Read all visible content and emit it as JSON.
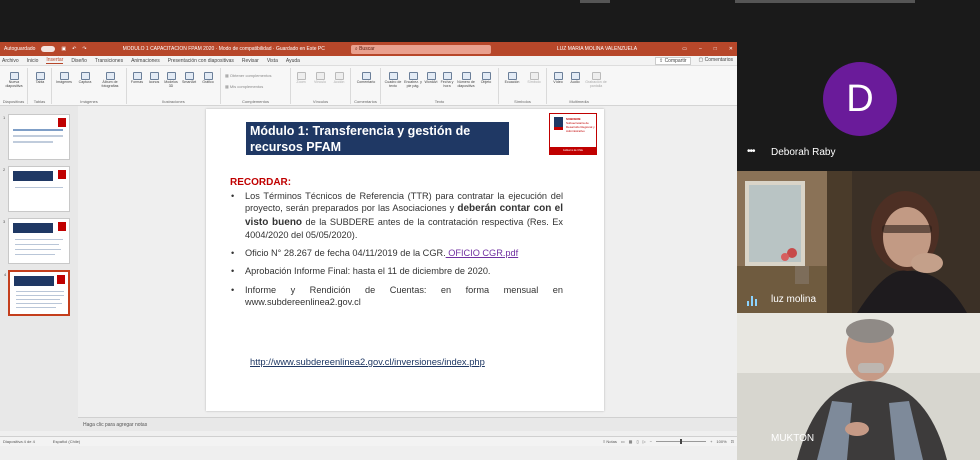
{
  "ppt": {
    "autosave_label": "Autoguardado",
    "title": "MODULO 1 CAPACITACION FPAM 2020 · Modo de compatibilidad · Guardado en Este PC",
    "search_placeholder": "Buscar",
    "user": "LUZ MARIA MOLINA VALENZUELA",
    "menu": [
      "Archivo",
      "Inicio",
      "Insertar",
      "Diseño",
      "Transiciones",
      "Animaciones",
      "Presentación con diapositivas",
      "Revisar",
      "Vista",
      "Ayuda"
    ],
    "active_menu": "Insertar",
    "share_label": "Compartir",
    "comments_label": "Comentarios",
    "ribbon_groups": [
      {
        "label": "Diapositivas",
        "buttons": [
          "Nueva diapositiva"
        ]
      },
      {
        "label": "Tablas",
        "buttons": [
          "Tabla"
        ]
      },
      {
        "label": "Imágenes",
        "buttons": [
          "Imágenes",
          "Captura",
          "Álbum de fotografías"
        ]
      },
      {
        "label": "Ilustraciones",
        "buttons": [
          "Formas",
          "Iconos",
          "Modelos 3D",
          "SmartArt",
          "Gráfico"
        ]
      },
      {
        "label": "Complementos",
        "buttons": [
          "Obtener complementos",
          "Mis complementos"
        ]
      },
      {
        "label": "Vínculos",
        "buttons": [
          "Zoom",
          "Vínculo",
          "Acción"
        ]
      },
      {
        "label": "Comentarios",
        "buttons": [
          "Comentario"
        ]
      },
      {
        "label": "Texto",
        "buttons": [
          "Cuadro de texto",
          "Encabez. y pie pág.",
          "WordArt",
          "Fecha y hora",
          "Número de diapositiva",
          "Objeto"
        ]
      },
      {
        "label": "Símbolos",
        "buttons": [
          "Ecuación",
          "Símbolo"
        ]
      },
      {
        "label": "Multimedia",
        "buttons": [
          "Vídeo",
          "Audio",
          "Grabación de pantalla"
        ]
      }
    ],
    "thumb_numbers": [
      "1",
      "2",
      "3",
      "4"
    ],
    "notes_placeholder": "Haga clic para agregar notas",
    "status_slide": "Diapositiva 4 de 4",
    "status_lang": "Español (Chile)",
    "status_notes": "Notas",
    "zoom": "100%"
  },
  "slide": {
    "title": "Módulo 1: Transferencia y gestión de recursos PFAM",
    "logo_text": "SUBDERE",
    "logo_subtext": "Subsecretaría de Desarrollo Regional y Administrativo",
    "logo_footer": "Gobierno de Chile",
    "recordar": "RECORDAR:",
    "b1_pre": "Los Términos Técnicos de Referencia (TTR) para contratar la ejecución del proyecto, serán preparados por las Asociaciones y ",
    "b1_bold": "deberán contar con el visto bueno",
    "b1_post": " de la SUBDERE antes de la contratación respectiva (Res. Ex 4004/2020 del 05/05/2020).",
    "b2_text": "Oficio N° 28.267 de fecha 04/11/2019 de la CGR.",
    "b2_link": " OFICIO CGR.pdf",
    "b3_text": "Aprobación Informe Final: hasta el 11 de diciembre de 2020.",
    "b4_text": "Informe y Rendición de Cuentas: en forma mensual en www.subdereenlinea2.gov.cl",
    "url": "http://www.subdereenlinea2.gov.cl/inversiones/index.php"
  },
  "participants": [
    {
      "name": "Deborah Raby",
      "initial": "D",
      "avatar_color": "#6a1b9a"
    },
    {
      "name": "luz molina"
    },
    {
      "name": "MUKTON"
    }
  ]
}
